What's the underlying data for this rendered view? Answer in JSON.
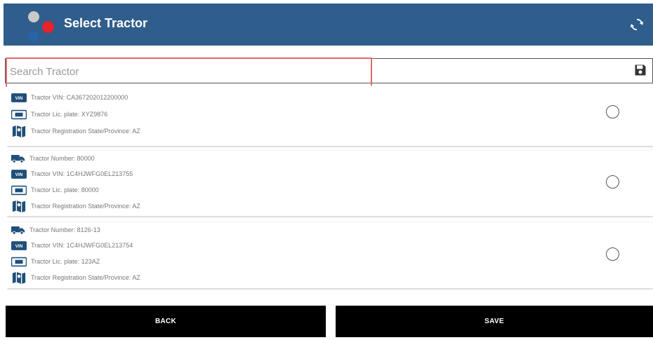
{
  "header": {
    "title": "Select Tractor",
    "refresh_icon": "refresh-icon"
  },
  "search": {
    "placeholder": "Search Tractor",
    "value": "",
    "save_icon": "save-icon"
  },
  "tractors": [
    {
      "number": "",
      "vin": "Tractor VIN: CA367202012200000",
      "plate": "Tractor Lic. plate: XYZ9876",
      "state": "Tractor Registration State/Province: AZ",
      "selected": false
    },
    {
      "number": "Tractor Number: 80000",
      "vin": "Tractor VIN: 1C4HJWFG0EL213755",
      "plate": "Tractor Lic. plate: 80000",
      "state": "Tractor Registration State/Province: AZ",
      "selected": false
    },
    {
      "number": "Tractor Number: 8126-13",
      "vin": "Tractor VIN: 1C4HJWFG0EL213754",
      "plate": "Tractor Lic. plate: 123AZ",
      "state": "Tractor Registration State/Province: AZ",
      "selected": false
    }
  ],
  "icons": {
    "number": "truck-icon",
    "vin": "vin-icon",
    "plate": "license-plate-icon",
    "state": "map-icon"
  },
  "buttons": {
    "back": "BACK",
    "save": "SAVE"
  },
  "colors": {
    "appbar": "#2f5d8c",
    "icon_blue": "#1f4f7a",
    "highlight": "#e06a6a",
    "button": "#000000"
  }
}
